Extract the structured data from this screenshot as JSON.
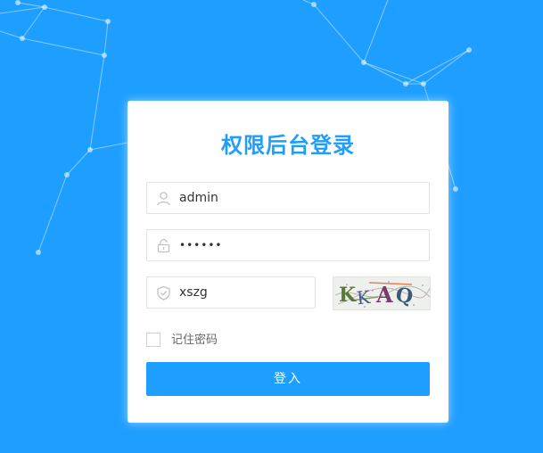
{
  "colors": {
    "background": "#1e9fff",
    "accent": "#1e9fff",
    "card": "#ffffff",
    "border": "#e2e2e2"
  },
  "login": {
    "title": "权限后台登录",
    "username": {
      "value": "admin",
      "icon": "user-icon"
    },
    "password": {
      "value": "••••••",
      "icon": "lock-icon"
    },
    "captcha_input": {
      "value": "xszg",
      "icon": "shield-icon"
    },
    "captcha_image": {
      "text": "KKAQ"
    },
    "remember": {
      "label": "记住密码",
      "checked": false
    },
    "submit_label": "登入"
  }
}
